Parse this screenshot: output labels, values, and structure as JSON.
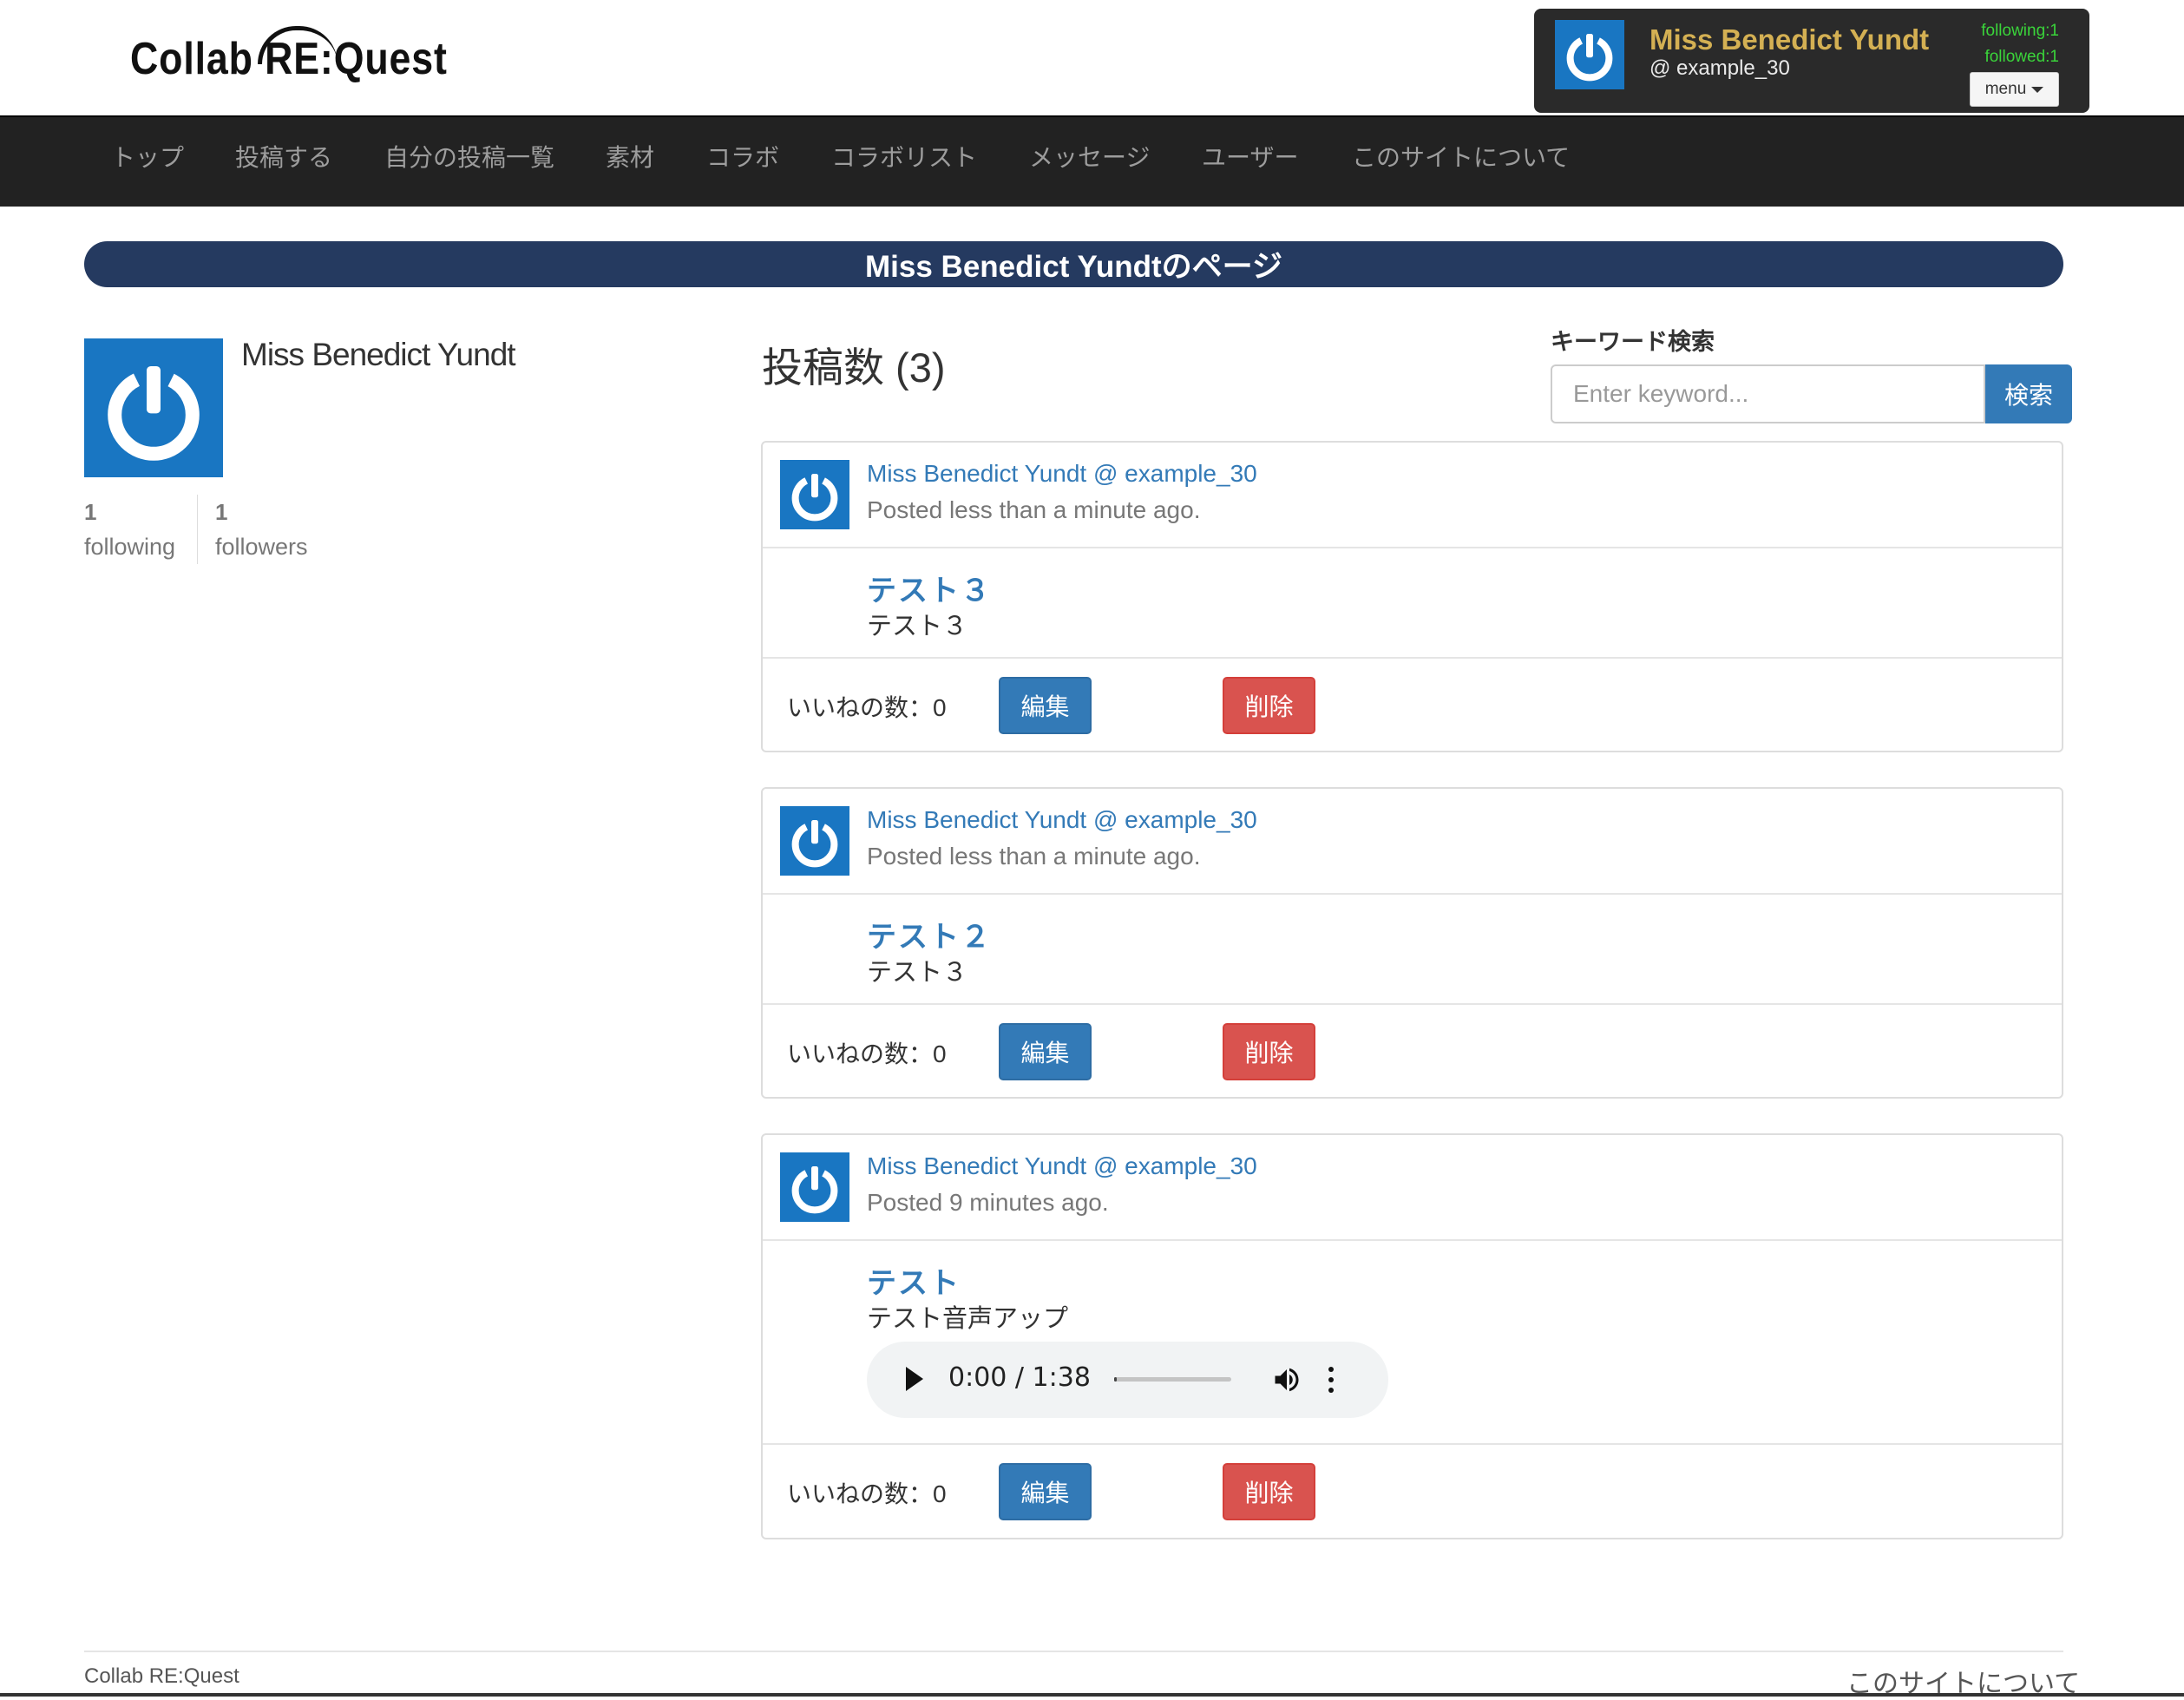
{
  "header": {
    "logo": "Collab RE:Quest",
    "user": {
      "name": "Miss Benedict Yundt",
      "handle": "@ example_30",
      "following": "following:1",
      "followed": "followed:1",
      "menu_label": "menu"
    }
  },
  "nav": {
    "items": [
      "トップ",
      "投稿する",
      "自分の投稿一覧",
      "素材",
      "コラボ",
      "コラボリスト",
      "メッセージ",
      "ユーザー",
      "このサイトについて"
    ]
  },
  "page": {
    "banner": "Miss Benedict Yundtのページ",
    "profile": {
      "name": "Miss Benedict Yundt",
      "following_count": "1",
      "following_label": "following",
      "followers_count": "1",
      "followers_label": "followers"
    },
    "posts_count": "投稿数 (3)",
    "search": {
      "label": "キーワード検索",
      "placeholder": "Enter keyword...",
      "button": "検索"
    }
  },
  "posts": [
    {
      "author": "Miss Benedict Yundt @ example_30",
      "time": "Posted less than a minute ago.",
      "title": "テスト３",
      "body": "テスト３",
      "likes": "いいねの数：0",
      "edit": "編集",
      "delete": "削除"
    },
    {
      "author": "Miss Benedict Yundt @ example_30",
      "time": "Posted less than a minute ago.",
      "title": "テスト２",
      "body": "テスト３",
      "likes": "いいねの数：0",
      "edit": "編集",
      "delete": "削除"
    },
    {
      "author": "Miss Benedict Yundt @ example_30",
      "time": "Posted 9 minutes ago.",
      "title": "テスト",
      "body": "テスト音声アップ",
      "audio_time": "0:00 / 1:38",
      "audio_progress": 0.0,
      "likes": "いいねの数：0",
      "edit": "編集",
      "delete": "削除"
    }
  ],
  "footer": {
    "left": "Collab RE:Quest",
    "right": "このサイトについて"
  },
  "colors": {
    "nav_bg": "#222222",
    "banner_bg": "#253a60",
    "primary": "#337ab7",
    "danger": "#d9534f",
    "username_gold": "#d4b053",
    "stat_green": "#3ad43a",
    "avatar_blue": "#1976c2"
  }
}
